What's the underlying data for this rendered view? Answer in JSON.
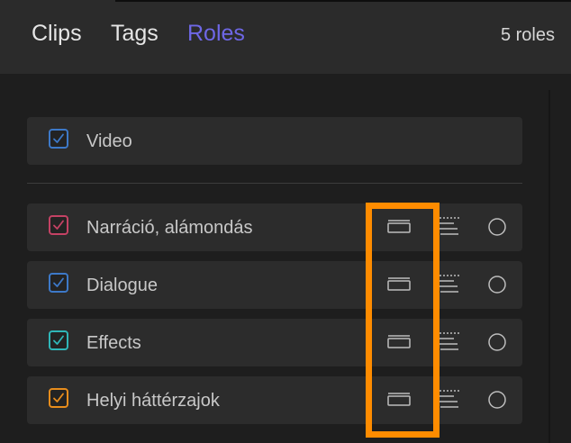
{
  "tabs": [
    {
      "label": "Clips",
      "active": false
    },
    {
      "label": "Tags",
      "active": false
    },
    {
      "label": "Roles",
      "active": true
    }
  ],
  "role_count": "5 roles",
  "colors": {
    "active_tab": "#6e67e6",
    "highlight": "#ff8c00"
  },
  "roles": [
    {
      "label": "Video",
      "checked": true,
      "color": "#3d79c8",
      "controls": false
    },
    {
      "label": "Narráció, alámondás",
      "checked": true,
      "color": "#c44264",
      "controls": true
    },
    {
      "label": "Dialogue",
      "checked": true,
      "color": "#3d79c8",
      "controls": true
    },
    {
      "label": "Effects",
      "checked": true,
      "color": "#2fb6b8",
      "controls": true
    },
    {
      "label": "Helyi háttérzajok",
      "checked": true,
      "color": "#e88d1c",
      "controls": true
    }
  ],
  "icons": {
    "checkmark": "checkmark-icon",
    "lane": "lane-icon",
    "subroles": "subroles-icon",
    "focus": "focus-circle-icon"
  }
}
